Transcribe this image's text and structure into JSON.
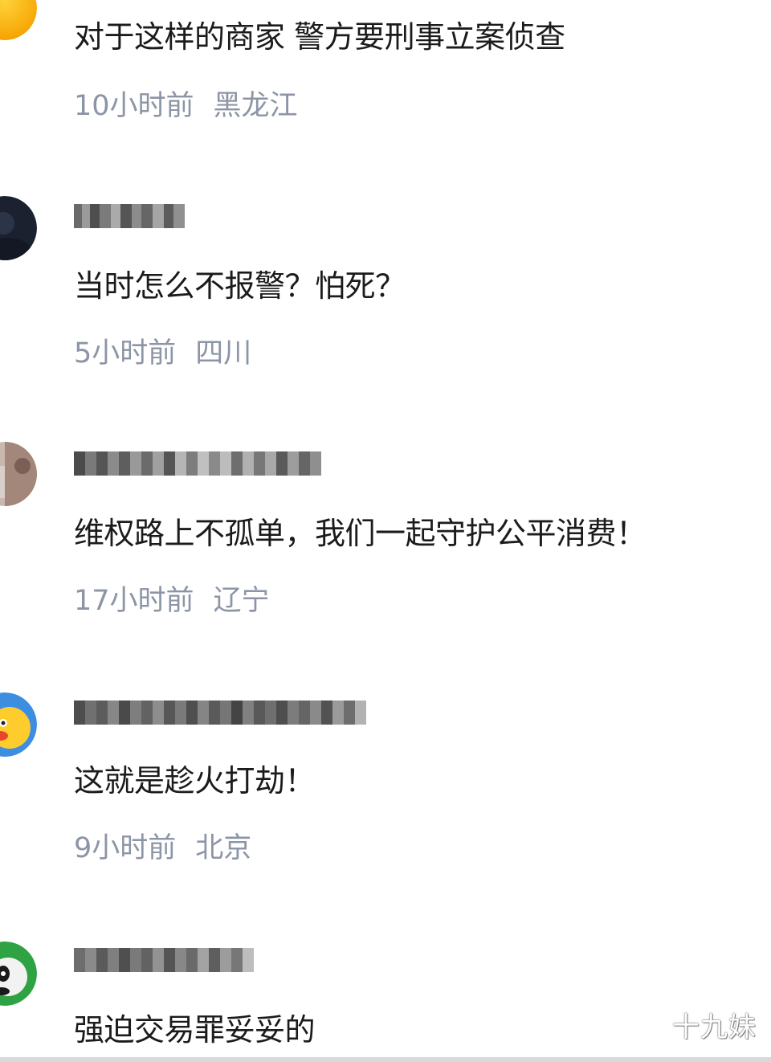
{
  "comments": [
    {
      "username": "",
      "text": "对于这样的商家 警方要刑事立案侦查",
      "time": "10小时前",
      "location": "黑龙江"
    },
    {
      "username": "",
      "text": "当时怎么不报警？怕死？",
      "time": "5小时前",
      "location": "四川"
    },
    {
      "username": "",
      "text": "维权路上不孤单，我们一起守护公平消费！",
      "time": "17小时前",
      "location": "辽宁"
    },
    {
      "username": "",
      "text": "这就是趁火打劫！",
      "time": "9小时前",
      "location": "北京"
    },
    {
      "username": "",
      "text": "强迫交易罪妥妥的",
      "time": "",
      "location": ""
    }
  ],
  "watermark": "十九妹",
  "colors": {
    "meta_text": "#8c95a6",
    "comment_text": "#1b1b1b",
    "background": "#ffffff"
  }
}
